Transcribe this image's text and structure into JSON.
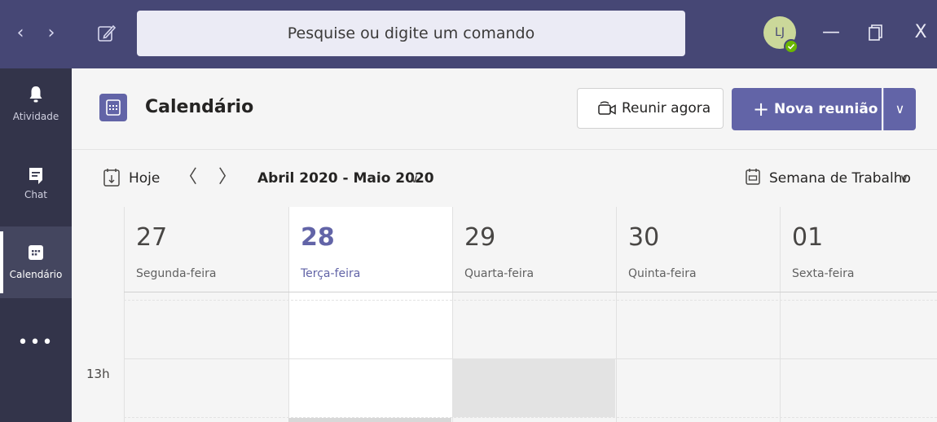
{
  "titlebar": {
    "back_arrow": "‹",
    "forward_arrow": "›",
    "compose_icon": "compose-icon",
    "search_placeholder": "Pesquise ou digite um comando",
    "avatar_initials": "LJ",
    "presence": "available",
    "minimize": "—",
    "restore": "❐",
    "close": "X"
  },
  "rail": {
    "items": [
      {
        "label": "Atividade",
        "icon": "bell-icon",
        "active": false
      },
      {
        "label": "Chat",
        "icon": "chat-icon",
        "active": false
      },
      {
        "label": "Calendário",
        "icon": "calendar-icon",
        "active": true
      }
    ],
    "more": "•••"
  },
  "header": {
    "title": "Calendário",
    "meet_now_label": "Reunir agora",
    "new_meeting_label": "Nova reunião",
    "new_meeting_plus": "+",
    "dropdown_chevron": "∨"
  },
  "toolbar": {
    "today_label": "Hoje",
    "prev": "〈",
    "next": "〉",
    "date_range": "Abril 2020 - Maio 2020",
    "range_chevron": "∨",
    "view_label": "Semana de Trabalho",
    "view_chevron": "∨"
  },
  "week": {
    "days": [
      {
        "num": "27",
        "name": "Segunda-feira",
        "today": false
      },
      {
        "num": "28",
        "name": "Terça-feira",
        "today": true
      },
      {
        "num": "29",
        "name": "Quarta-feira",
        "today": false
      },
      {
        "num": "30",
        "name": "Quinta-feira",
        "today": false
      },
      {
        "num": "01",
        "name": "Sexta-feira",
        "today": false
      }
    ],
    "time_label": "13h"
  },
  "colors": {
    "titlebar": "#464775",
    "rail": "#33344a",
    "accent": "#6264a7",
    "presence": "#6bb700"
  }
}
